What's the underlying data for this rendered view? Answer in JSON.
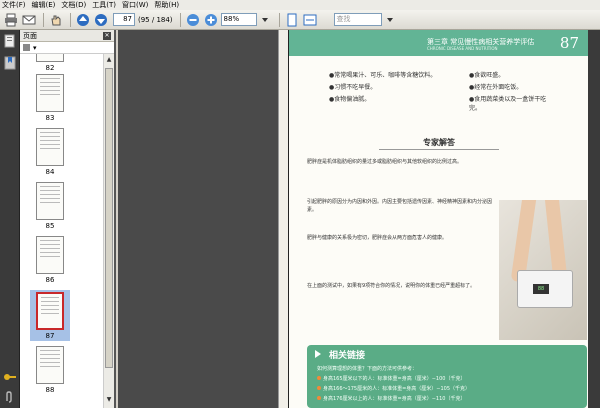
{
  "menubar": {
    "items": [
      "文件(F)",
      "编辑(E)",
      "文档(D)",
      "工具(T)",
      "窗口(W)",
      "帮助(H)"
    ]
  },
  "toolbar": {
    "page_current": "87",
    "page_total": "(95 / 184)",
    "zoom": "88%",
    "search_placeholder": "查找"
  },
  "sidebar": {
    "panel_title": "页面",
    "panel_options": "▾",
    "thumbnails": [
      {
        "label": "82"
      },
      {
        "label": "83"
      },
      {
        "label": "84"
      },
      {
        "label": "85"
      },
      {
        "label": "86"
      },
      {
        "label": "87",
        "selected": true
      },
      {
        "label": "88"
      }
    ]
  },
  "document": {
    "chapter_title": "第三章  常见慢性病相关营养学评估",
    "chapter_subtitle": "CHRONIC DISEASE AND NUTRITION",
    "page_number": "87",
    "tips": [
      "●常常喝果汁、可乐、咖啡等含糖饮料。",
      "●食欲旺盛。",
      "●习惯不吃早餐。",
      "●经常在外面吃饭。",
      "●食物偏油腻。",
      "●食用蔬菜类以及一盒饼干吃完。"
    ],
    "section_title": "专家解答",
    "paragraphs": [
      "肥胖症是机体脂肪组织的量过多或脂肪组织与其他软组织的比例过高。",
      "引起肥胖的原因分为内因和外因。内因主要包括遗传因素、神经精神因素和内分泌因素。",
      "肥胖与健康的关系极为密切，肥胖症会从两方面危害人的健康。",
      "在上面的测试中，如果有9项符合你的情况，说明你的体重已经严重超标了。"
    ],
    "related_title": "相关链接",
    "related_lines": [
      "如何测算理想的体重？下面的方法可供参考：",
      "身高165厘米以下的人：标准体重=身高（厘米）−100（千克）",
      "身高166～175厘米的人：标准体重=身高（厘米）−105（千克）",
      "身高176厘米以上的人：标准体重=身高（厘米）−110（千克）"
    ]
  },
  "colors": {
    "accent_green": "#62b495",
    "selection": "#a6c1e6",
    "bullet_orange": "#e46e2e"
  }
}
